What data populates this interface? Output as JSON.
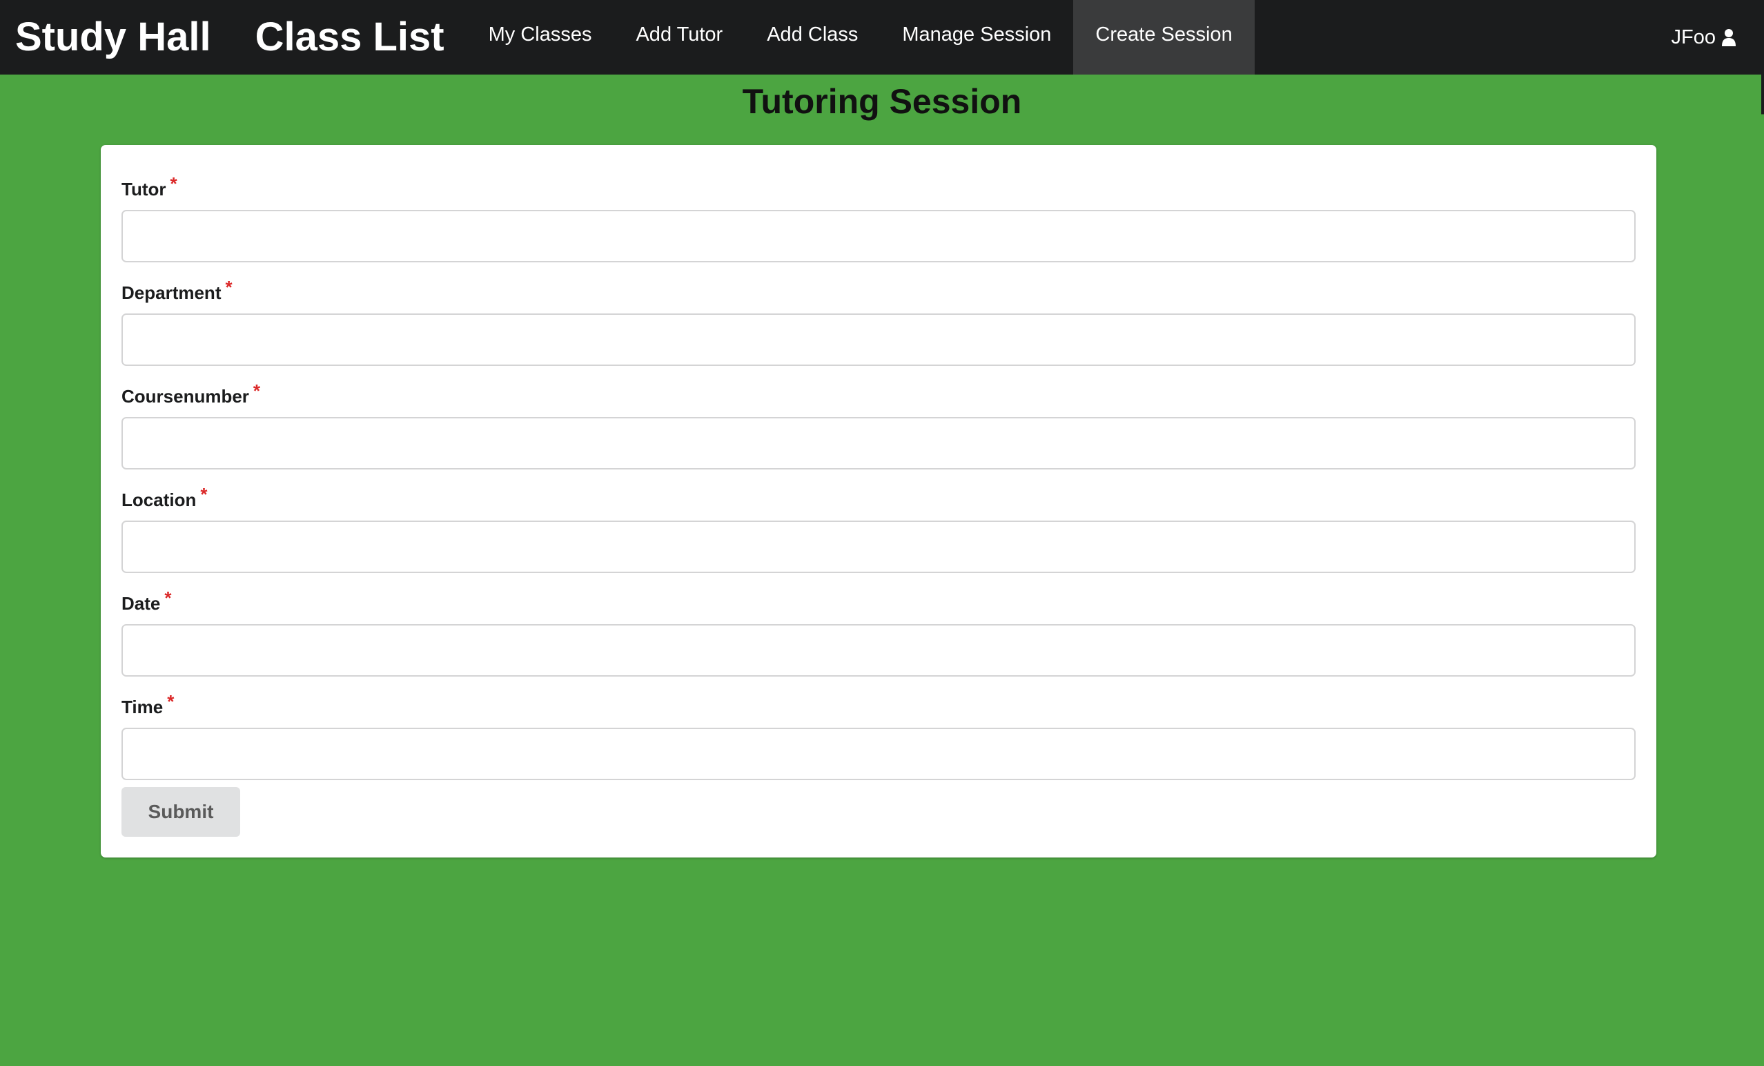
{
  "navbar": {
    "brand": "Study Hall",
    "brand_secondary": "Class List",
    "items": [
      {
        "label": "My Classes"
      },
      {
        "label": "Add Tutor"
      },
      {
        "label": "Add Class"
      },
      {
        "label": "Manage Session"
      },
      {
        "label": "Create Session",
        "active": true
      }
    ],
    "user": {
      "name": "JFoo",
      "icon": "user-icon"
    }
  },
  "page": {
    "title": "Tutoring Session"
  },
  "form": {
    "fields": [
      {
        "label": "Tutor",
        "required": "*",
        "value": ""
      },
      {
        "label": "Department",
        "required": "*",
        "value": ""
      },
      {
        "label": "Coursenumber",
        "required": "*",
        "value": ""
      },
      {
        "label": "Location",
        "required": "*",
        "value": ""
      },
      {
        "label": "Date",
        "required": "*",
        "value": ""
      },
      {
        "label": "Time",
        "required": "*",
        "value": ""
      }
    ],
    "submit_label": "Submit"
  },
  "colors": {
    "background": "#4ca541",
    "navbar": "#1b1c1d",
    "active_nav": "#3a3b3c",
    "required": "#db2828",
    "button": "#e0e1e2"
  }
}
